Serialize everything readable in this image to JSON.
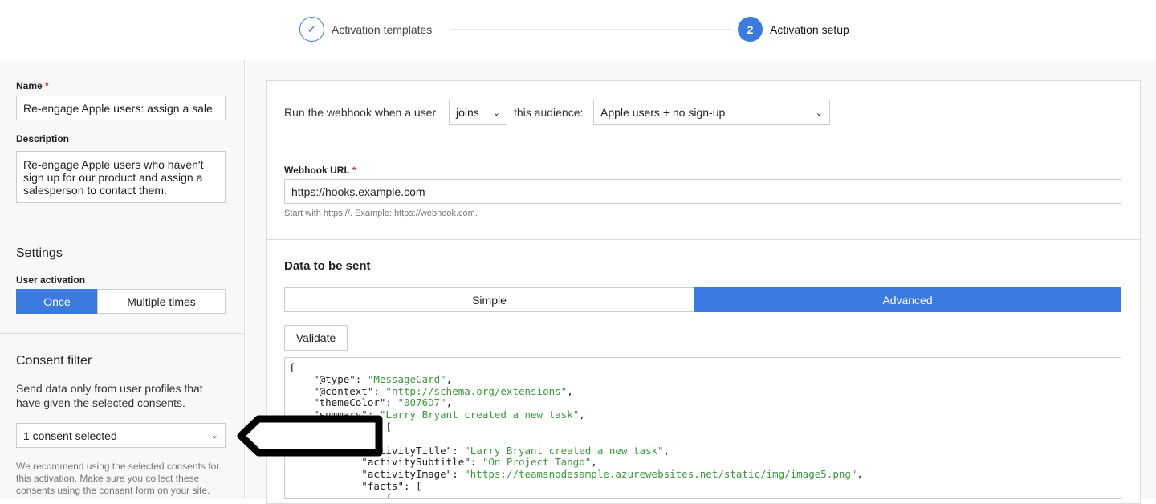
{
  "stepper": {
    "steps": [
      {
        "label": "Activation templates",
        "state": "done"
      },
      {
        "number": "2",
        "label": "Activation setup",
        "state": "active"
      }
    ]
  },
  "sidebar": {
    "name_label": "Name",
    "name_value": "Re-engage Apple users: assign a sale",
    "description_label": "Description",
    "description_value": "Re-engage Apple users who haven't sign up for our product and assign a salesperson to contact them.",
    "settings_title": "Settings",
    "user_activation_label": "User activation",
    "activation_options": [
      "Once",
      "Multiple times"
    ],
    "activation_selected": "Once",
    "consent_title": "Consent filter",
    "consent_desc": "Send data only from user profiles that have given the selected consents.",
    "consent_select": "1 consent selected",
    "consent_hint": "We recommend using the selected consents for this activation. Make sure you collect these consents using the consent form on your site."
  },
  "trigger": {
    "prefix": "Run the webhook when a user",
    "event": "joins",
    "middle": "this audience:",
    "audience": "Apple users + no sign-up"
  },
  "webhook": {
    "label": "Webhook URL",
    "value": "https://hooks.example.com",
    "hint": "Start with https://. Example: https://webhook.com."
  },
  "data": {
    "title": "Data to be sent",
    "modes": [
      "Simple",
      "Advanced"
    ],
    "selected": "Advanced",
    "validate": "Validate",
    "code_lines": [
      [
        "{",
        ""
      ],
      [
        "    \"@type\": ",
        "\"MessageCard\"",
        ","
      ],
      [
        "    \"@context\": ",
        "\"http://schema.org/extensions\"",
        ","
      ],
      [
        "    \"themeColor\": ",
        "\"0076D7\"",
        ","
      ],
      [
        "    \"summary\": ",
        "\"Larry Bryant created a new task\"",
        ","
      ],
      [
        "    \"sections\": [",
        "",
        ""
      ],
      [
        "        {",
        "",
        ""
      ],
      [
        "            \"activityTitle\": ",
        "\"Larry Bryant created a new task\"",
        ","
      ],
      [
        "            \"activitySubtitle\": ",
        "\"On Project Tango\"",
        ","
      ],
      [
        "            \"activityImage\": ",
        "\"https://teamsnodesample.azurewebsites.net/static/img/image5.png\"",
        ","
      ],
      [
        "            \"facts\": [",
        "",
        ""
      ],
      [
        "                {",
        "",
        ""
      ]
    ]
  },
  "colors": {
    "accent": "#3b7be0",
    "string": "#3a9a3a",
    "required": "#dd3333"
  }
}
